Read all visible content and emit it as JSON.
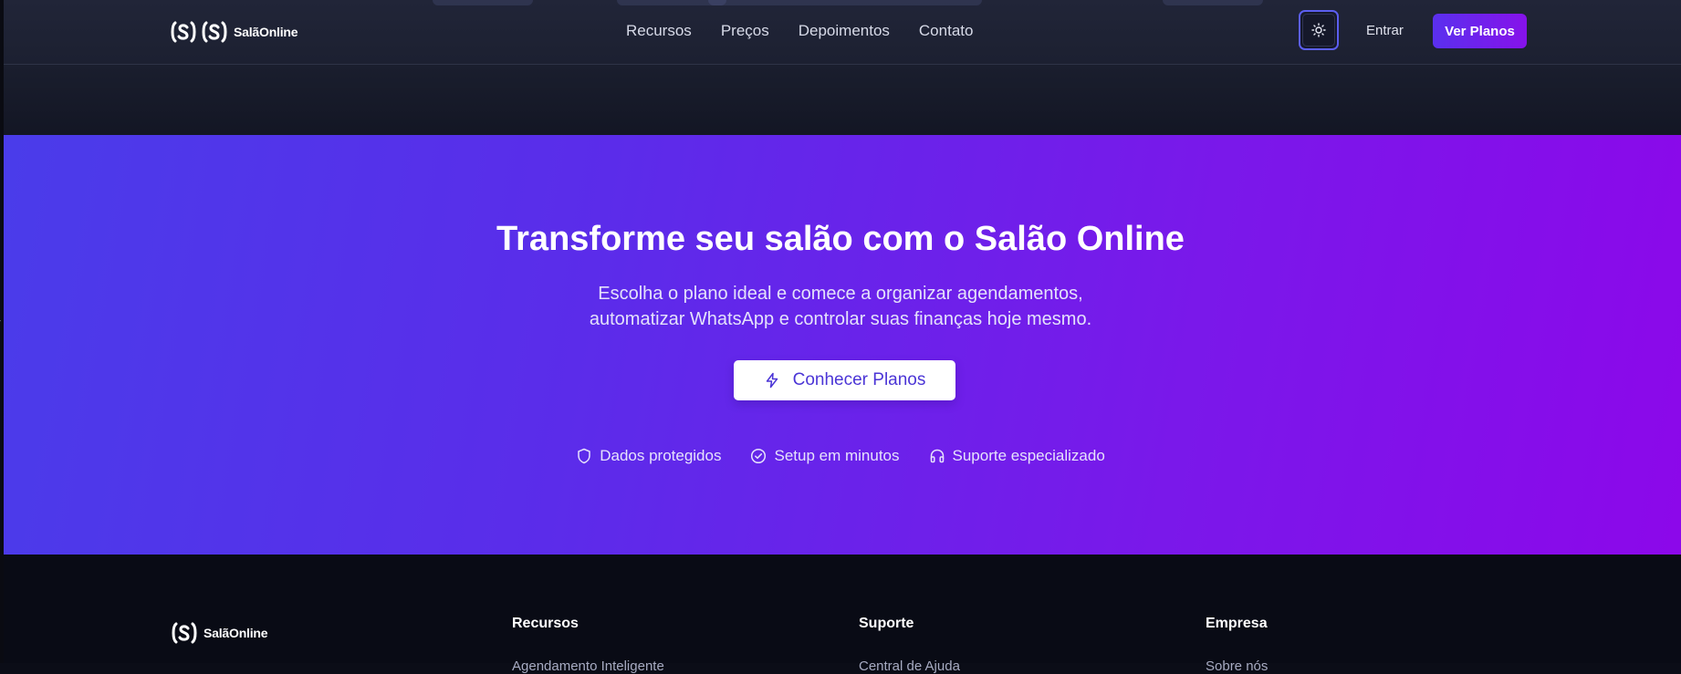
{
  "header": {
    "logo_text": "SalãOnline",
    "nav": [
      {
        "label": "Recursos"
      },
      {
        "label": "Preços"
      },
      {
        "label": "Depoimentos"
      },
      {
        "label": "Contato"
      }
    ],
    "theme_toggle_icon": "sun-icon",
    "login_label": "Entrar",
    "cta_label": "Ver Planos"
  },
  "hero": {
    "title": "Transforme seu salão com o Salão Online",
    "subtitle_line1": "Escolha o plano ideal e comece a organizar agendamentos,",
    "subtitle_line2": "automatizar WhatsApp e controlar suas finanças hoje mesmo.",
    "cta_label": "Conhecer Planos",
    "cta_icon": "lightning-icon",
    "trust": [
      {
        "icon": "shield-icon",
        "label": "Dados protegidos"
      },
      {
        "icon": "check-circle-icon",
        "label": "Setup em minutos"
      },
      {
        "icon": "headphones-icon",
        "label": "Suporte especializado"
      }
    ]
  },
  "footer": {
    "logo_text": "SalãOnline",
    "columns": [
      {
        "title": "Recursos",
        "first_link": "Agendamento Inteligente"
      },
      {
        "title": "Suporte",
        "first_link": "Central de Ajuda"
      },
      {
        "title": "Empresa",
        "first_link": "Sobre nós"
      }
    ]
  },
  "colors": {
    "accent": "#5b5ef0",
    "hero_gradient_start": "#4a3cea",
    "hero_gradient_end": "#8c08ea",
    "cta_start": "#5a30ee",
    "cta_end": "#8612ea",
    "page_background": "#0b0d17"
  }
}
